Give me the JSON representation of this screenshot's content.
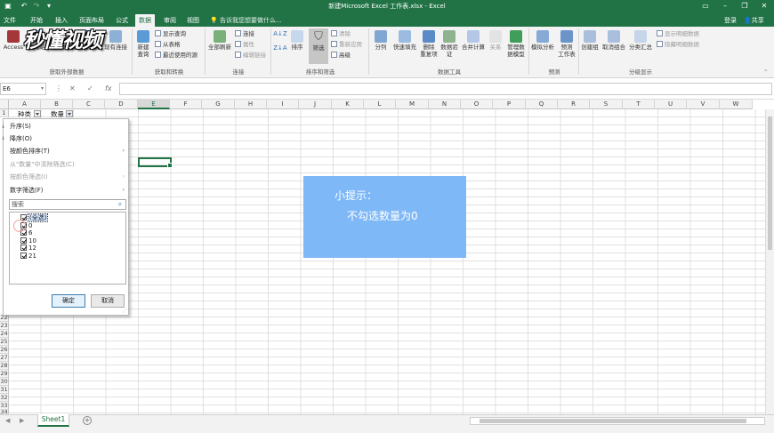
{
  "window": {
    "title": "新建Microsoft Excel 工作表.xlsx - Excel"
  },
  "tabs": [
    "文件",
    "开始",
    "插入",
    "页面布局",
    "公式",
    "数据",
    "审阅",
    "视图"
  ],
  "active_tab": "数据",
  "tell_me": "告诉我您想要做什么...",
  "account": {
    "login": "登录",
    "share": "共享"
  },
  "watermark": "秒懂视频",
  "ribbon": {
    "get_external": {
      "access": "Access",
      "web": "自网站",
      "text": "自文本",
      "other": "自其他来源",
      "existing": "现有连接",
      "group": "获取外部数据"
    },
    "get_transform": {
      "new_query": "新建\n查询",
      "show_queries": "显示查询",
      "from_table": "从表格",
      "recent": "最近使用的源",
      "group": "获取和转换"
    },
    "connections": {
      "refresh_all": "全部刷新",
      "connections": "连接",
      "properties": "属性",
      "edit_links": "编辑链接",
      "group": "连接"
    },
    "sort_filter": {
      "sort": "排序",
      "filter": "筛选",
      "clear": "清除",
      "reapply": "重新应用",
      "advanced": "高级",
      "group": "排序和筛选"
    },
    "data_tools": {
      "text_to_columns": "分列",
      "flash_fill": "快速填充",
      "remove_dup": "删除\n重复项",
      "validation": "数据验\n证",
      "consolidate": "合并计算",
      "relations": "关系",
      "manage_model": "管理数\n据模型",
      "group": "数据工具"
    },
    "forecast": {
      "what_if": "模拟分析",
      "forecast_sheet": "预测\n工作表",
      "group": "预测"
    },
    "outline": {
      "group_btn": "创建组",
      "ungroup": "取消组合",
      "subtotal": "分类汇总",
      "show_detail": "显示明细数据",
      "hide_detail": "隐藏明细数据",
      "group": "分级显示"
    }
  },
  "formula_bar": {
    "name_box": "E6",
    "formula": ""
  },
  "columns": [
    "A",
    "B",
    "C",
    "D",
    "E",
    "F",
    "G",
    "H",
    "I",
    "J",
    "K",
    "L",
    "M",
    "N",
    "O",
    "P",
    "Q",
    "R",
    "S",
    "T",
    "U",
    "V",
    "W"
  ],
  "selected_column": "E",
  "rows_visible": [
    "1",
    "22",
    "23",
    "24",
    "25",
    "26",
    "27",
    "28",
    "29",
    "30",
    "31",
    "32",
    "33",
    "34"
  ],
  "cells": {
    "a1": "种类",
    "b1": "数量"
  },
  "filter_menu": {
    "items": [
      {
        "label": "升序(S)",
        "enabled": true,
        "arrow": false
      },
      {
        "label": "降序(O)",
        "enabled": true,
        "arrow": false
      },
      {
        "label": "按颜色排序(T)",
        "enabled": true,
        "arrow": true
      },
      {
        "label": "从\"数量\"中清除筛选(C)",
        "enabled": false,
        "arrow": false
      },
      {
        "label": "按颜色筛选(I)",
        "enabled": false,
        "arrow": true
      },
      {
        "label": "数字筛选(F)",
        "enabled": true,
        "arrow": true
      }
    ],
    "search_placeholder": "搜索",
    "values": [
      {
        "label": "(全选)",
        "checked": true
      },
      {
        "label": "0",
        "checked": true
      },
      {
        "label": "6",
        "checked": true
      },
      {
        "label": "10",
        "checked": true
      },
      {
        "label": "12",
        "checked": true
      },
      {
        "label": "21",
        "checked": true
      }
    ],
    "ok": "确定",
    "cancel": "取消"
  },
  "hint": {
    "title": "小提示：",
    "body": "不勾选数量为0"
  },
  "sheets": [
    "Sheet1"
  ],
  "colors": {
    "excel_green": "#217346",
    "hint_bg": "#7fb8f7"
  }
}
